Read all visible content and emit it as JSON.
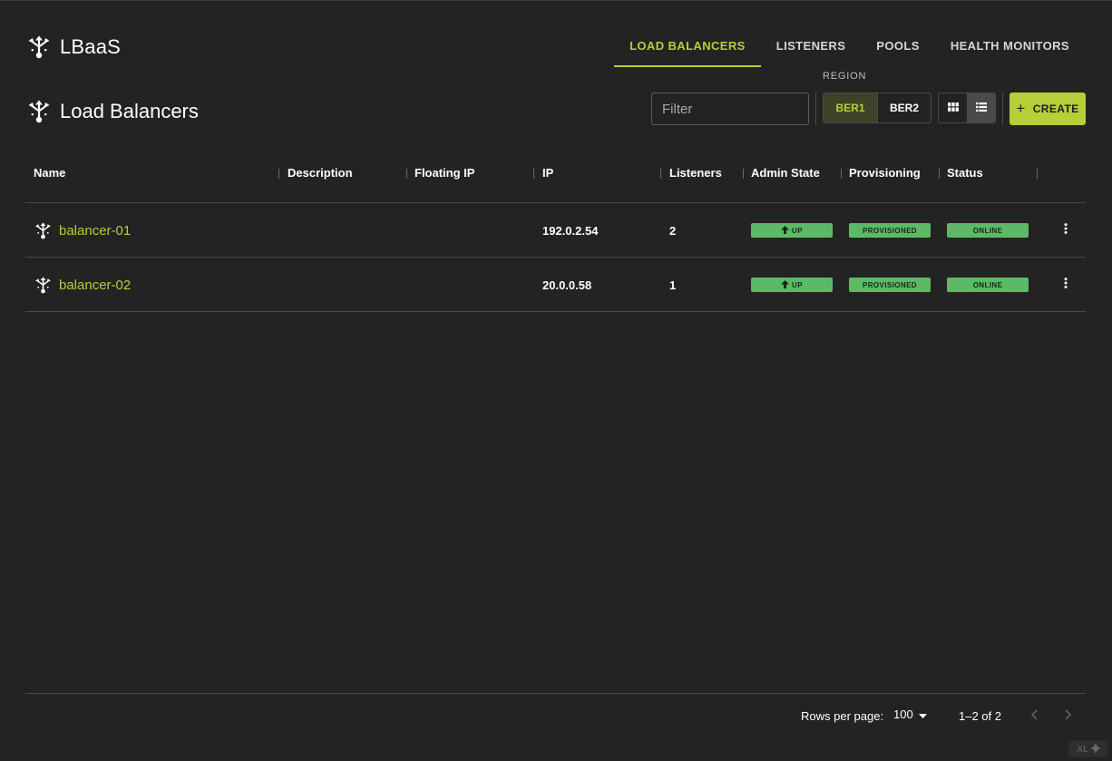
{
  "app": {
    "title": "LBaaS"
  },
  "nav": {
    "tabs": [
      {
        "label": "LOAD BALANCERS",
        "active": true
      },
      {
        "label": "LISTENERS",
        "active": false
      },
      {
        "label": "POOLS",
        "active": false
      },
      {
        "label": "HEALTH MONITORS",
        "active": false
      }
    ]
  },
  "page": {
    "title": "Load Balancers"
  },
  "toolbar": {
    "filter_placeholder": "Filter",
    "region_label": "REGION",
    "regions": [
      {
        "label": "BER1",
        "active": true
      },
      {
        "label": "BER2",
        "active": false
      }
    ],
    "view_modes": [
      {
        "icon": "grid-view-icon",
        "active": false
      },
      {
        "icon": "list-view-icon",
        "active": true
      }
    ],
    "create_label": "CREATE"
  },
  "table": {
    "columns": [
      "Name",
      "Description",
      "Floating IP",
      "IP",
      "Listeners",
      "Admin State",
      "Provisioning",
      "Status"
    ],
    "rows": [
      {
        "name": "balancer-01",
        "description": "",
        "floating_ip": "",
        "ip": "192.0.2.54",
        "listeners": "2",
        "admin_state": "UP",
        "provisioning": "PROVISIONED",
        "status": "ONLINE"
      },
      {
        "name": "balancer-02",
        "description": "",
        "floating_ip": "",
        "ip": "20.0.0.58",
        "listeners": "1",
        "admin_state": "UP",
        "provisioning": "PROVISIONED",
        "status": "ONLINE"
      }
    ]
  },
  "pagination": {
    "rows_per_page_label": "Rows per page:",
    "rows_per_page_value": "100",
    "range": "1–2 of 2"
  },
  "corner_badge": "XL",
  "colors": {
    "accent": "#b5cf38",
    "background": "#232323",
    "status_green": "#5cba66"
  }
}
